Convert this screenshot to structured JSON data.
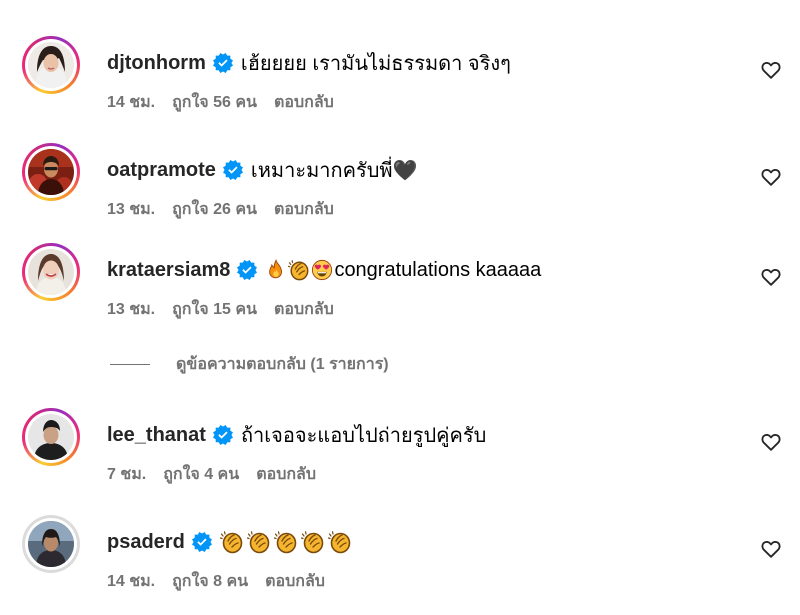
{
  "colors": {
    "verified": "#0095f6",
    "meta_text": "#737373",
    "username": "#262626"
  },
  "comments": [
    {
      "username": "djtonhorm",
      "verified": true,
      "text": "เฮ้ยยยย เรามันไม่ธรรมดา จริงๆ",
      "emojis": [],
      "time": "14 ชม.",
      "likes": "ถูกใจ 56 คน",
      "reply": "ตอบกลับ",
      "heart_icon": "heart-outline-icon"
    },
    {
      "username": "oatpramote",
      "verified": true,
      "text": "เหมาะมากครับพี่🖤",
      "emojis": [],
      "time": "13 ชม.",
      "likes": "ถูกใจ 26 คน",
      "reply": "ตอบกลับ",
      "heart_icon": "heart-outline-icon"
    },
    {
      "username": "krataersiam8",
      "verified": true,
      "text": "congratulations kaaaaa",
      "emojis": [
        "fire",
        "clapping-hands",
        "heart-eyes"
      ],
      "time": "13 ชม.",
      "likes": "ถูกใจ 15 คน",
      "reply": "ตอบกลับ",
      "heart_icon": "heart-outline-icon"
    },
    {
      "username": "lee_thanat",
      "verified": true,
      "text": "ถ้าเจอจะแอบไปถ่ายรูปคู่ครับ",
      "emojis": [],
      "time": "7 ชม.",
      "likes": "ถูกใจ 4 คน",
      "reply": "ตอบกลับ",
      "heart_icon": "heart-outline-icon"
    },
    {
      "username": "psaderd",
      "verified": true,
      "text": "",
      "emojis": [
        "clapping-hands",
        "clapping-hands",
        "clapping-hands",
        "clapping-hands",
        "clapping-hands"
      ],
      "time": "14 ชม.",
      "likes": "ถูกใจ 8 คน",
      "reply": "ตอบกลับ",
      "heart_icon": "heart-outline-icon"
    }
  ],
  "view_replies": {
    "label": "ดูข้อความตอบกลับ (1 รายการ)"
  }
}
